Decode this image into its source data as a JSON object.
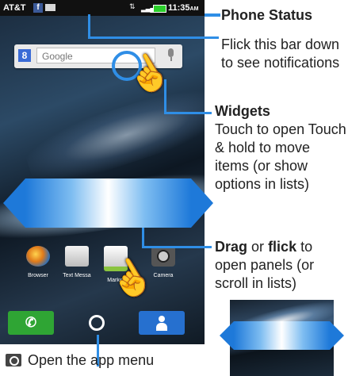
{
  "status_bar": {
    "carrier": "AT&T",
    "facebook_badge": "f",
    "time": "11:35",
    "time_suffix": "AM",
    "icons": [
      "facebook-icon",
      "mail-icon",
      "network-icon",
      "signal-icon",
      "battery-icon"
    ]
  },
  "search_widget": {
    "badge": "8",
    "placeholder": "Google",
    "mic_icon": "microphone-icon"
  },
  "apps": [
    {
      "label": "Browser",
      "icon": "browser-icon"
    },
    {
      "label": "Text Messa",
      "icon": "text-message-icon"
    },
    {
      "label": "Market",
      "icon": "market-icon"
    },
    {
      "label": "Camera",
      "icon": "camera-icon"
    }
  ],
  "dock": {
    "phone_icon": "phone-icon",
    "menu_icon": "app-menu-icon",
    "contacts_icon": "contacts-icon"
  },
  "callouts": {
    "phone_status": "Phone Status",
    "flick_bar": "Flick this bar down to see notifications",
    "widgets_title": "Widgets",
    "widgets_text": "Touch to open Touch & hold to move items (or show options in lists)",
    "drag_word": "Drag",
    "or_word": "or",
    "flick_word": "flick",
    "drag_rest": "to open panels (or scroll in lists)",
    "app_menu": "Open the app menu"
  },
  "colors": {
    "accent_blue": "#2f8ee6",
    "phone_green": "#2fa534",
    "contacts_blue": "#2670cf"
  }
}
